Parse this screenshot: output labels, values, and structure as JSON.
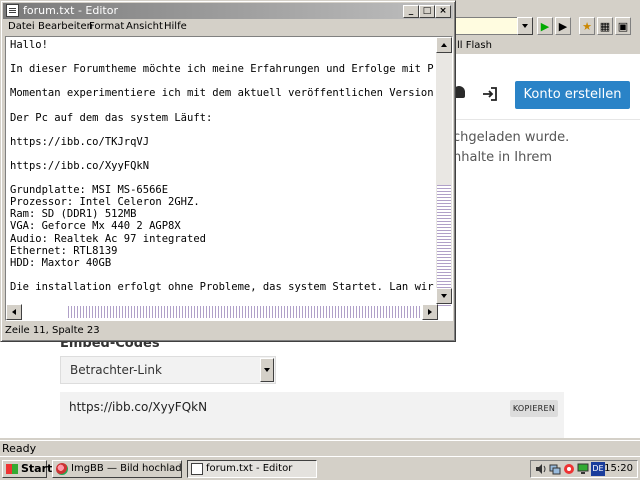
{
  "browser": {
    "bookmarks_text": "ll Flash",
    "status": "Ready"
  },
  "site": {
    "signup_button": "Konto erstellen",
    "body_line1": "chgeladen wurde.",
    "body_line2": "nhalte in Ihrem",
    "embed_label": "Embed-Codes",
    "viewer_select_value": "Betrachter-Link",
    "embed_code_value": "https://ibb.co/XyyFQkN",
    "copy_button": "KOPIEREN"
  },
  "notepad": {
    "title": "forum.txt - Editor",
    "menu": [
      "Datei",
      "Bearbeiten",
      "Format",
      "Ansicht",
      "Hilfe"
    ],
    "lines": [
      "Hallo!",
      "",
      "In dieser Forumtheme möchte ich meine Erfahrungen und Erfolge mit P",
      "",
      "Momentan experimentiere ich mit dem aktuell veröffentlichen Version",
      "",
      "Der Pc auf dem das system Läuft:",
      "",
      "https://ibb.co/TKJrqVJ",
      "",
      "https://ibb.co/XyyFQkN",
      "",
      "Grundplatte: MSI MS-6566E",
      "Prozessor: Intel Celeron 2GHZ.",
      "Ram: SD (DDR1) 512MB",
      "VGA: Geforce Mx 440 2 AGP8X",
      "Audio: Realtek Ac 97 integrated",
      "Ethernet: RTL8139",
      "HDD: Maxtor 40GB",
      "",
      "Die installation erfolgt ohne Probleme, das system Startet. Lan wir"
    ],
    "status": "Zeile 11, Spalte 23"
  },
  "taskbar": {
    "start": "Start",
    "tasks": [
      {
        "label": "ImgBB — Bild hochladen — ..."
      },
      {
        "label": "forum.txt - Editor"
      }
    ],
    "language": "DE",
    "clock": "15:20"
  },
  "colors": {
    "signup_blue": "#2a83c7",
    "titlebar_inactive": "#7a7a7a"
  }
}
